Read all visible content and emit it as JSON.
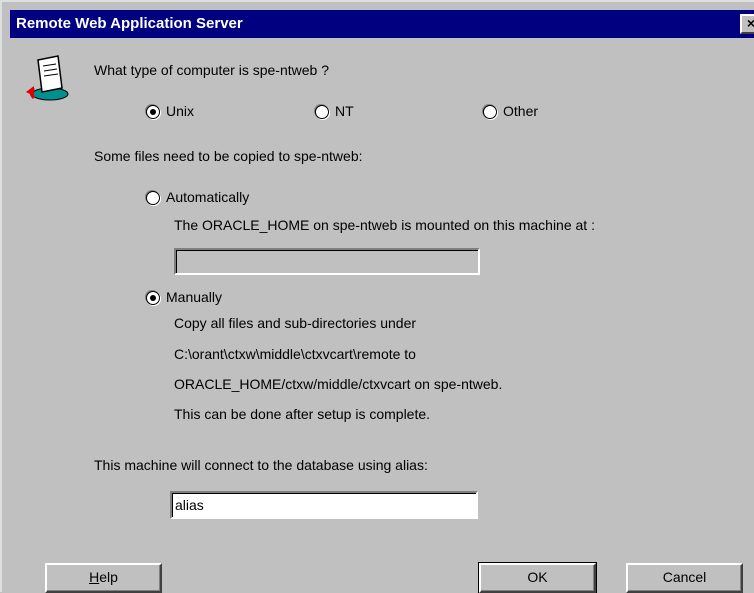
{
  "window": {
    "title": "Remote Web Application Server",
    "close_label": "×"
  },
  "question": "What type of computer is spe-ntweb ?",
  "os_options": [
    {
      "label": "Unix",
      "checked": true
    },
    {
      "label": "NT",
      "checked": false
    },
    {
      "label": "Other",
      "checked": false
    }
  ],
  "copy_intro": "Some files need to be copied to spe-ntweb:",
  "auto_option": {
    "label": "Automatically",
    "checked": false,
    "description": "The ORACLE_HOME on spe-ntweb is mounted on this machine at :",
    "path_value": ""
  },
  "manual_option": {
    "label": "Manually",
    "checked": true,
    "lines": [
      "Copy all files and sub-directories under",
      "C:\\orant\\ctxw\\middle\\ctxvcart\\remote to",
      "ORACLE_HOME/ctxw/middle/ctxvcart on spe-ntweb.",
      "This can be done after setup is complete."
    ]
  },
  "alias_prompt": "This machine will connect to the database using alias:",
  "alias_value": "alias",
  "buttons": {
    "help": "Help",
    "ok": "OK",
    "cancel": "Cancel"
  },
  "icons": {
    "dialog_icon": "setup-document-icon"
  }
}
